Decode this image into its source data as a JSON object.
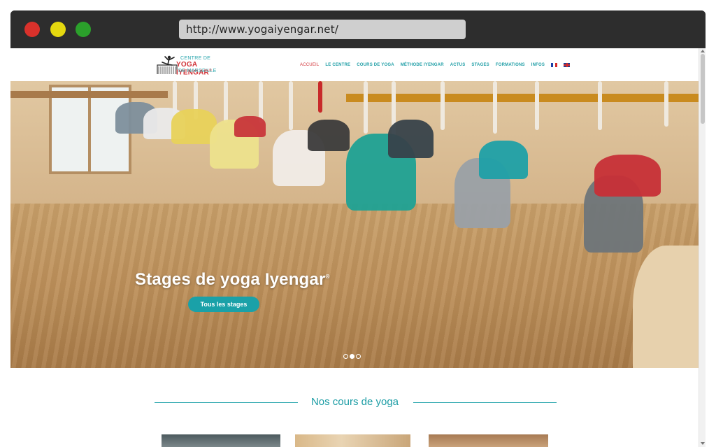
{
  "browser": {
    "url": "http://www.yogaiyengar.net/"
  },
  "site": {
    "logo": {
      "line1": "CENTRE DE",
      "line2": "YOGA IYENGAR",
      "line2_mark": "®",
      "line3": "DE MARSEILLE"
    },
    "nav": [
      {
        "label": "ACCUEIL",
        "active": true
      },
      {
        "label": "LE CENTRE"
      },
      {
        "label": "COURS DE YOGA"
      },
      {
        "label": "MÉTHODE IYENGAR"
      },
      {
        "label": "ACTUS"
      },
      {
        "label": "STAGES"
      },
      {
        "label": "FORMATIONS"
      },
      {
        "label": "INFOS"
      }
    ],
    "languages": [
      "fr-flag-icon",
      "uk-flag-icon"
    ]
  },
  "hero": {
    "title": "Stages de yoga Iyengar",
    "title_mark": "®",
    "button": "Tous les stages",
    "slides": 3,
    "active_slide": 2
  },
  "section": {
    "title": "Nos cours de yoga"
  },
  "colors": {
    "accent": "#1aa1a8",
    "brand_red": "#d2353a",
    "chrome": "#2d2d2d"
  }
}
